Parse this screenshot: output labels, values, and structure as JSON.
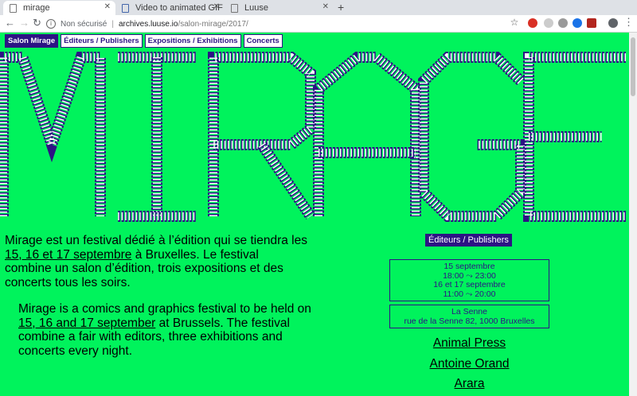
{
  "browser": {
    "tabs": [
      {
        "title": "mirage",
        "active": true
      },
      {
        "title": "Video to animated GIF co",
        "active": false
      },
      {
        "title": "Luuse",
        "active": false
      }
    ],
    "new_tab": "+",
    "security_label": "Non sécurisé",
    "url_host": "archives.luuse.io",
    "url_path": "/salon-mirage/2017/"
  },
  "nav": {
    "items": [
      {
        "label": "Salon Mirage",
        "current": true
      },
      {
        "label": "Éditeurs / Publishers",
        "current": false
      },
      {
        "label": "Expositions / Exhibitions",
        "current": false
      },
      {
        "label": "Concerts",
        "current": false
      }
    ]
  },
  "logo": {
    "text": "MIRAGE"
  },
  "intro_fr": {
    "p1": "Mirage est un festival dédié à l’édition qui se tiendra les ",
    "dates": "15, 16 et 17 septembre",
    "p2": " à Bruxelles. Le festival combine un salon d’édition, trois expositions et des concerts tous les soirs."
  },
  "intro_en": {
    "p1": "Mirage is a comics and graphics festival to be held on ",
    "dates": "15, 16 and 17 september",
    "p2": " at Brussels. The festival combine a fair with editors, three exhibitions and concerts every night."
  },
  "sidebar": {
    "publishers_button": "Éditeurs / Publishers",
    "schedule": [
      "15 septembre",
      "18:00 ⤳ 23:00",
      "16 et 17 septembre",
      "11:00 ⤳ 20:00"
    ],
    "venue_name": "La Senne",
    "venue_address": "rue de la Senne 82, 1000 Bruxelles",
    "publishers": [
      "Animal Press",
      "Antoine Orand",
      "Arara"
    ]
  },
  "colors": {
    "background": "#00f35c",
    "accent": "#2c1384"
  }
}
